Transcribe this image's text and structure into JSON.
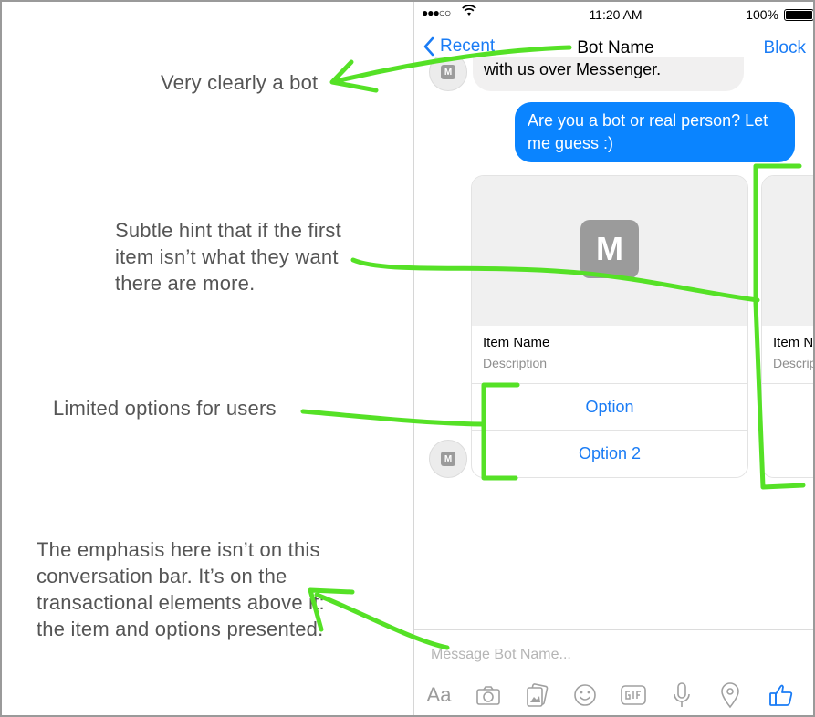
{
  "annotations": {
    "bot": "Very clearly a bot",
    "hint": "Subtle hint that if the first item isn’t what they want there are more.",
    "limited": "Limited options for users",
    "emphasis": "The emphasis here isn’t on this conversation bar. It’s on the transactional elements above it: the item and options presented."
  },
  "status": {
    "time": "11:20 AM",
    "battery": "100%"
  },
  "nav": {
    "back": "Recent",
    "title": "Bot Name",
    "action": "Block"
  },
  "messages": {
    "incoming": "with us over Messenger.",
    "outgoing": "Are you a bot or real person? Let me guess :)"
  },
  "avatar_letter": "M",
  "cards": [
    {
      "name": "Item Name",
      "description": "Description",
      "options": [
        "Option",
        "Option 2"
      ]
    },
    {
      "name": "Item Name",
      "description": "Description"
    }
  ],
  "composer": {
    "placeholder": "Message Bot Name...",
    "aa": "Aa"
  },
  "icons": [
    "camera-icon",
    "gallery-icon",
    "emoji-icon",
    "gif-icon",
    "microphone-icon",
    "location-icon",
    "like-icon"
  ],
  "colors": {
    "accent": "#1a7cf5",
    "outgoing_bubble": "#0a84ff",
    "annotation_stroke": "#55e126",
    "annotation_text": "#555555"
  }
}
